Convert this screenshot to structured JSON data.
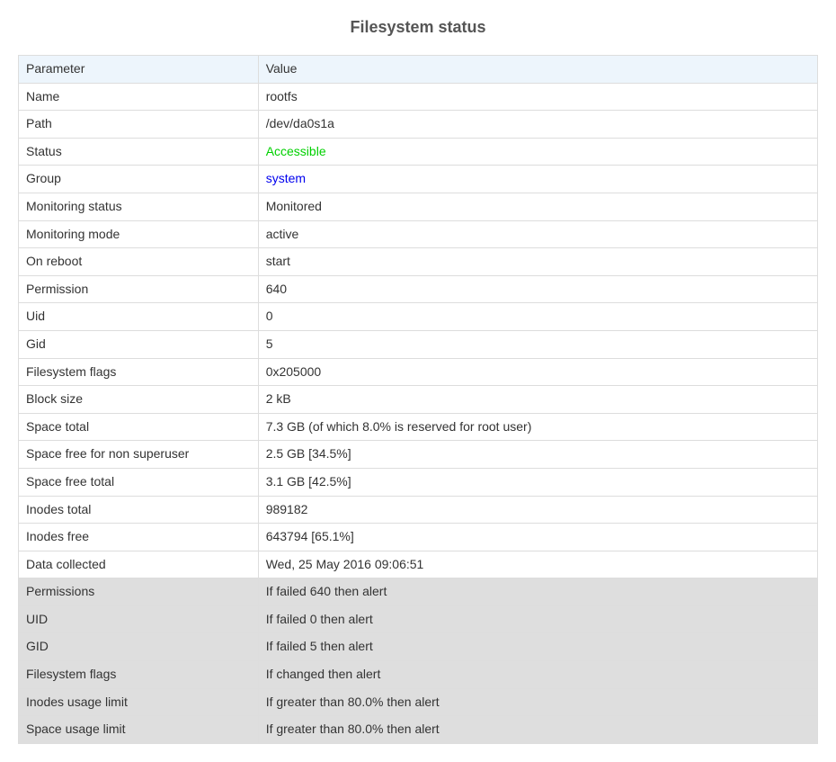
{
  "title": "Filesystem status",
  "headers": {
    "param": "Parameter",
    "value": "Value"
  },
  "rows": [
    {
      "param": "Name",
      "value": "rootfs"
    },
    {
      "param": "Path",
      "value": "/dev/da0s1a"
    },
    {
      "param": "Status",
      "value": "Accessible",
      "class": "status-accessible"
    },
    {
      "param": "Group",
      "value": "system",
      "link": true
    },
    {
      "param": "Monitoring status",
      "value": "Monitored"
    },
    {
      "param": "Monitoring mode",
      "value": "active"
    },
    {
      "param": "On reboot",
      "value": "start"
    },
    {
      "param": "Permission",
      "value": "640"
    },
    {
      "param": "Uid",
      "value": "0"
    },
    {
      "param": "Gid",
      "value": "5"
    },
    {
      "param": "Filesystem flags",
      "value": "0x205000"
    },
    {
      "param": "Block size",
      "value": "2 kB"
    },
    {
      "param": "Space total",
      "value": "7.3 GB (of which 8.0% is reserved for root user)"
    },
    {
      "param": "Space free for non superuser",
      "value": "2.5 GB [34.5%]"
    },
    {
      "param": "Space free total",
      "value": "3.1 GB [42.5%]"
    },
    {
      "param": "Inodes total",
      "value": "989182"
    },
    {
      "param": "Inodes free",
      "value": "643794 [65.1%]"
    },
    {
      "param": "Data collected",
      "value": "Wed, 25 May 2016 09:06:51"
    },
    {
      "param": "Permissions",
      "value": "If failed 640 then alert",
      "shaded": true
    },
    {
      "param": "UID",
      "value": "If failed 0 then alert",
      "shaded": true
    },
    {
      "param": "GID",
      "value": "If failed 5 then alert",
      "shaded": true
    },
    {
      "param": "Filesystem flags",
      "value": "If changed then alert",
      "shaded": true
    },
    {
      "param": "Inodes usage limit",
      "value": "If greater than 80.0% then alert",
      "shaded": true
    },
    {
      "param": "Space usage limit",
      "value": "If greater than 80.0% then alert",
      "shaded": true
    }
  ]
}
